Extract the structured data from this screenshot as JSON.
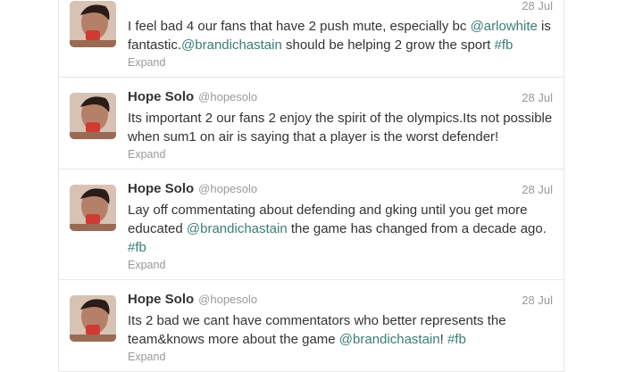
{
  "feed": {
    "tweets": [
      {
        "fullname": "",
        "handle": "",
        "time": "28 Jul",
        "segments": [
          {
            "text": "I feel bad 4 our fans that have 2 push mute, especially bc ",
            "link": false
          },
          {
            "text": "@arlowhite",
            "link": true
          },
          {
            "text": " is fantastic.",
            "link": false
          },
          {
            "text": "@brandichastain",
            "link": true
          },
          {
            "text": " should be helping 2 grow the sport ",
            "link": false
          },
          {
            "text": "#fb",
            "link": true
          }
        ],
        "expand_label": "Expand"
      },
      {
        "fullname": "Hope Solo",
        "handle": "@hopesolo",
        "time": "28 Jul",
        "segments": [
          {
            "text": "Its important 2 our fans 2 enjoy the spirit of the olympics.Its not possible when sum1 on air is saying that a player is the worst defender!",
            "link": false
          }
        ],
        "expand_label": "Expand"
      },
      {
        "fullname": "Hope Solo",
        "handle": "@hopesolo",
        "time": "28 Jul",
        "segments": [
          {
            "text": "Lay off commentating about defending and gking until you get more educated ",
            "link": false
          },
          {
            "text": "@brandichastain",
            "link": true
          },
          {
            "text": " the game has changed from a decade ago. ",
            "link": false
          },
          {
            "text": "#fb",
            "link": true
          }
        ],
        "expand_label": "Expand"
      },
      {
        "fullname": "Hope Solo",
        "handle": "@hopesolo",
        "time": "28 Jul",
        "segments": [
          {
            "text": "Its 2 bad we cant have commentators who better represents the team&knows more about the game ",
            "link": false
          },
          {
            "text": "@brandichastain",
            "link": true
          },
          {
            "text": "! ",
            "link": false
          },
          {
            "text": "#fb",
            "link": true
          }
        ],
        "expand_label": "Expand"
      }
    ]
  }
}
